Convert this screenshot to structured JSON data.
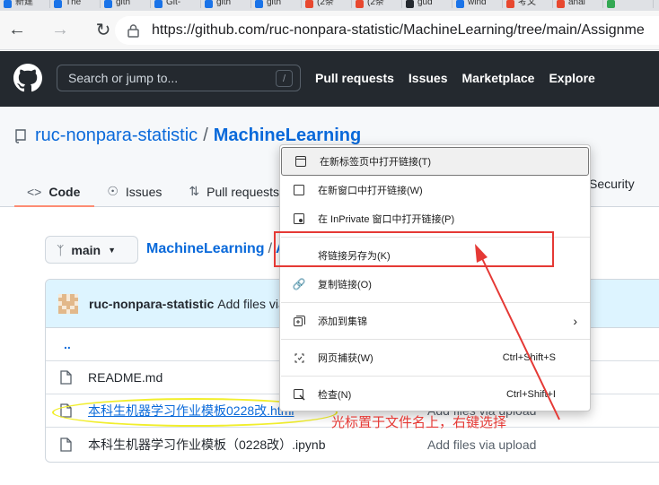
{
  "browser": {
    "tabs": [
      {
        "label": "新建",
        "color": "#1a73e8"
      },
      {
        "label": "The",
        "color": "#1a73e8"
      },
      {
        "label": "gith",
        "color": "#1a73e8"
      },
      {
        "label": "Git-",
        "color": "#1a73e8"
      },
      {
        "label": "gith",
        "color": "#1a73e8"
      },
      {
        "label": "gith",
        "color": "#1a73e8"
      },
      {
        "label": "(2条",
        "color": "#e8482f"
      },
      {
        "label": "(2条",
        "color": "#e8482f"
      },
      {
        "label": "gud",
        "color": "#24292f"
      },
      {
        "label": "wind",
        "color": "#1a73e8"
      },
      {
        "label": "考文",
        "color": "#e8482f"
      },
      {
        "label": "anal",
        "color": "#e8482f"
      },
      {
        "label": "",
        "color": "#34a853"
      }
    ],
    "url": "https://github.com/ruc-nonpara-statistic/MachineLearning/tree/main/Assignme"
  },
  "gh": {
    "search_placeholder": "Search or jump to...",
    "slash_key": "/",
    "nav": [
      "Pull requests",
      "Issues",
      "Marketplace",
      "Explore"
    ]
  },
  "repo": {
    "owner": "ruc-nonpara-statistic",
    "name": "MachineLearning",
    "tabs": {
      "code": "Code",
      "issues": "Issues",
      "pulls": "Pull requests",
      "security": "Security"
    },
    "branch": "main",
    "path_root": "MachineLearning",
    "path_sep": "/",
    "path_next": "A"
  },
  "commit": {
    "author": "ruc-nonpara-statistic",
    "message": "Add files via"
  },
  "files": {
    "parent": "..",
    "readme": "README.md",
    "html_file": "本科生机器学习作业模板0228改.html",
    "html_msg": "Add files via upload",
    "ipynb_file": "本科生机器学习作业模板（0228改）.ipynb",
    "ipynb_msg": "Add files via upload"
  },
  "context_menu": {
    "open_new_tab": "在新标签页中打开链接(T)",
    "open_new_window": "在新窗口中打开链接(W)",
    "open_inprivate": "在 InPrivate 窗口中打开链接(P)",
    "save_link_as": "将链接另存为(K)",
    "copy_link": "复制链接(O)",
    "add_to_collections": "添加到集锦",
    "web_capture": "网页捕获(W)",
    "web_capture_shortcut": "Ctrl+Shift+S",
    "inspect": "检查(N)",
    "inspect_shortcut": "Ctrl+Shift+I"
  },
  "annotation": {
    "text": "光标置于文件名上，右键选择",
    "box_color": "#e53935",
    "ellipse_color": "#f1ee2d"
  }
}
